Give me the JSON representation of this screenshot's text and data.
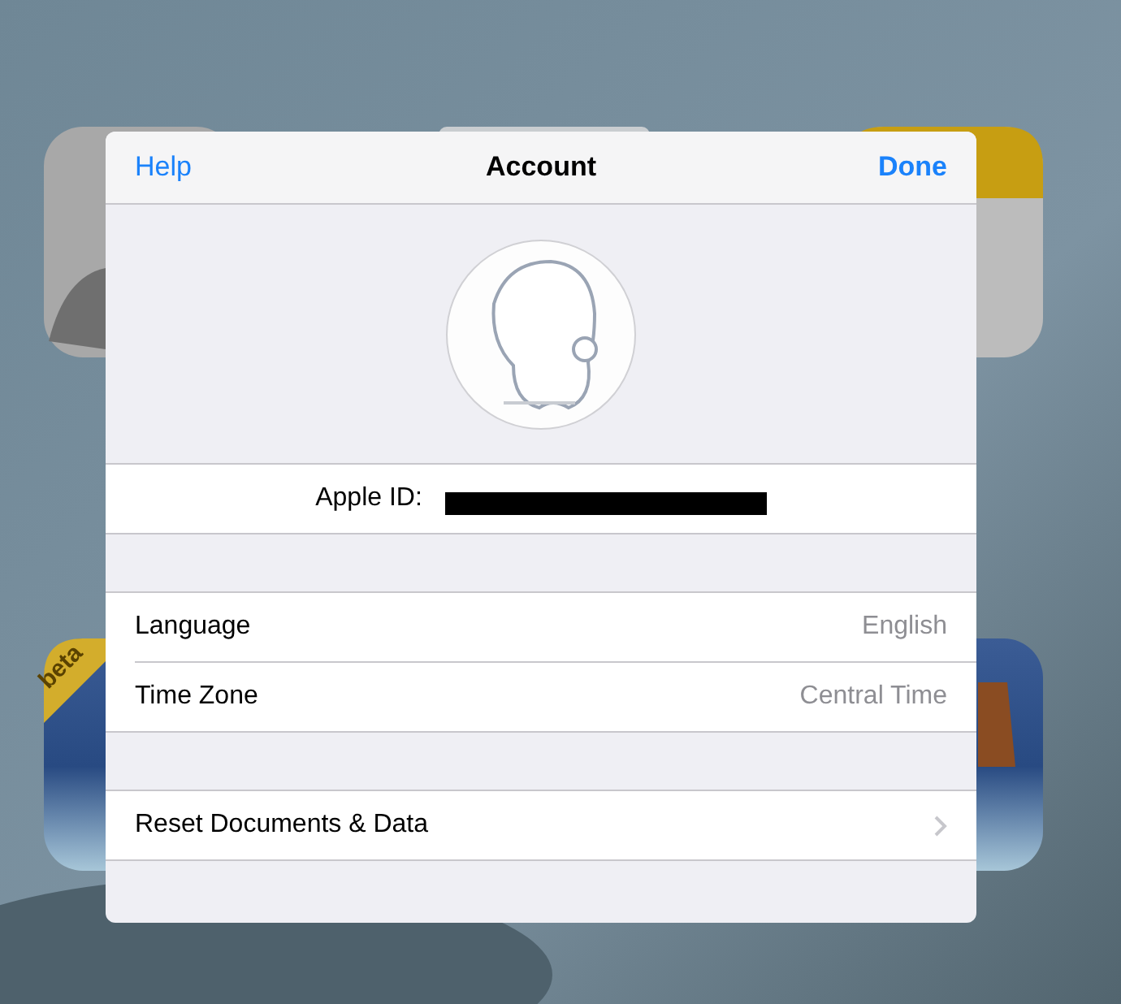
{
  "navigation_bar": {
    "left_button": "Help",
    "title": "Account",
    "right_button": "Done"
  },
  "profile": {
    "apple_id_label": "Apple ID:",
    "apple_id_redacted": true
  },
  "settings": [
    {
      "label": "Language",
      "value": "English"
    },
    {
      "label": "Time Zone",
      "value": "Central Time"
    }
  ],
  "actions": [
    {
      "label": "Reset Documents & Data",
      "disclosure": true
    }
  ],
  "background": {
    "badge": "beta"
  }
}
